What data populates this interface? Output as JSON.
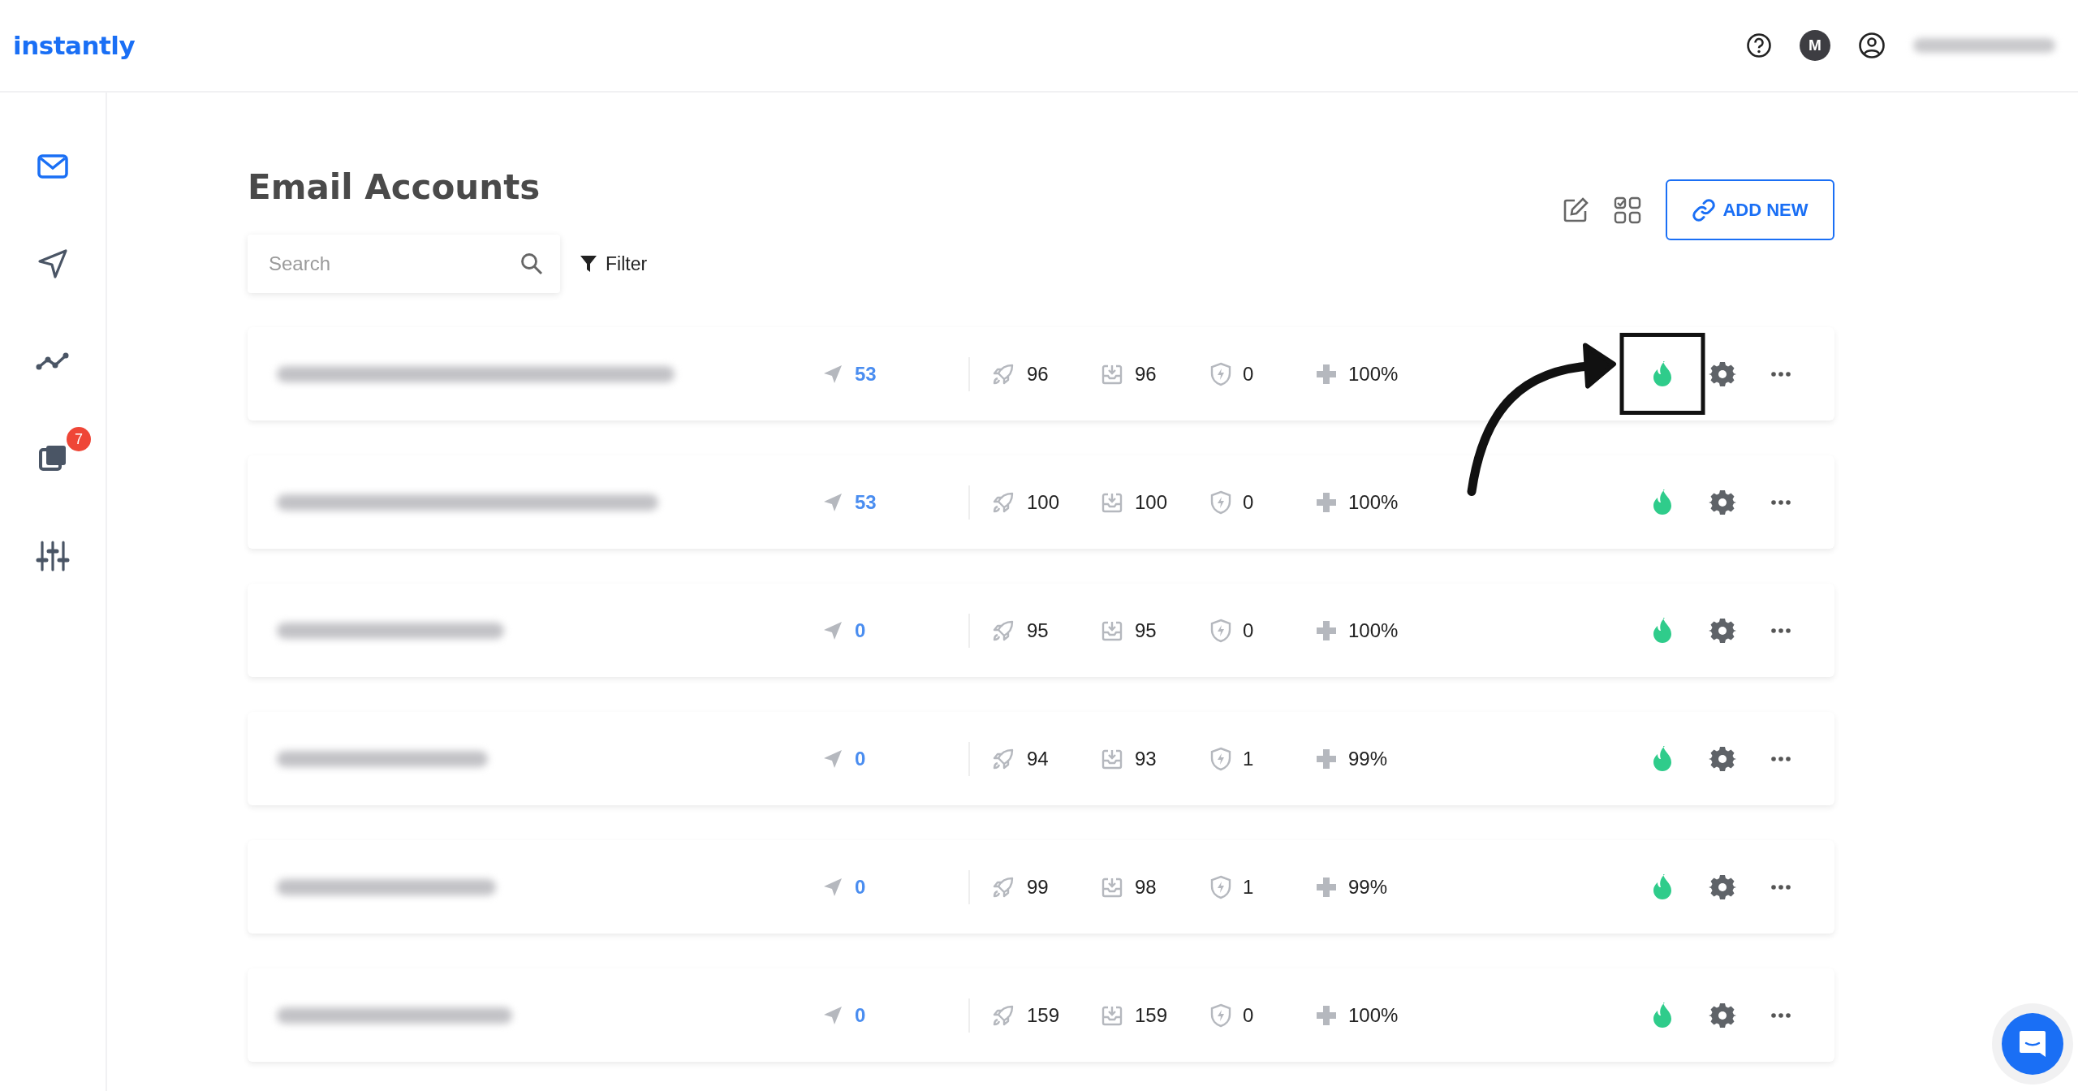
{
  "header": {
    "logo": "instantly",
    "avatar_initial": "M"
  },
  "sidebar": {
    "items": [
      {
        "kind": "mail",
        "selected": true
      },
      {
        "kind": "send",
        "selected": false
      },
      {
        "kind": "analytics",
        "selected": false
      },
      {
        "kind": "copies",
        "selected": false,
        "badge": "7"
      },
      {
        "kind": "sliders",
        "selected": false
      }
    ]
  },
  "page": {
    "title": "Email Accounts",
    "search": {
      "placeholder": "Search"
    },
    "filter": "Filter",
    "add_button": "ADD NEW"
  },
  "accounts": [
    {
      "sent": "53",
      "warmup_sent": "96",
      "landed_inbox": "96",
      "saved_from_spam": "0",
      "health": "100%",
      "highlighted": true
    },
    {
      "sent": "53",
      "warmup_sent": "100",
      "landed_inbox": "100",
      "saved_from_spam": "0",
      "health": "100%",
      "highlighted": false
    },
    {
      "sent": "0",
      "warmup_sent": "95",
      "landed_inbox": "95",
      "saved_from_spam": "0",
      "health": "100%",
      "highlighted": false
    },
    {
      "sent": "0",
      "warmup_sent": "94",
      "landed_inbox": "93",
      "saved_from_spam": "1",
      "health": "99%",
      "highlighted": false
    },
    {
      "sent": "0",
      "warmup_sent": "99",
      "landed_inbox": "98",
      "saved_from_spam": "1",
      "health": "99%",
      "highlighted": false
    },
    {
      "sent": "0",
      "warmup_sent": "159",
      "landed_inbox": "159",
      "saved_from_spam": "0",
      "health": "100%",
      "highlighted": false
    }
  ]
}
